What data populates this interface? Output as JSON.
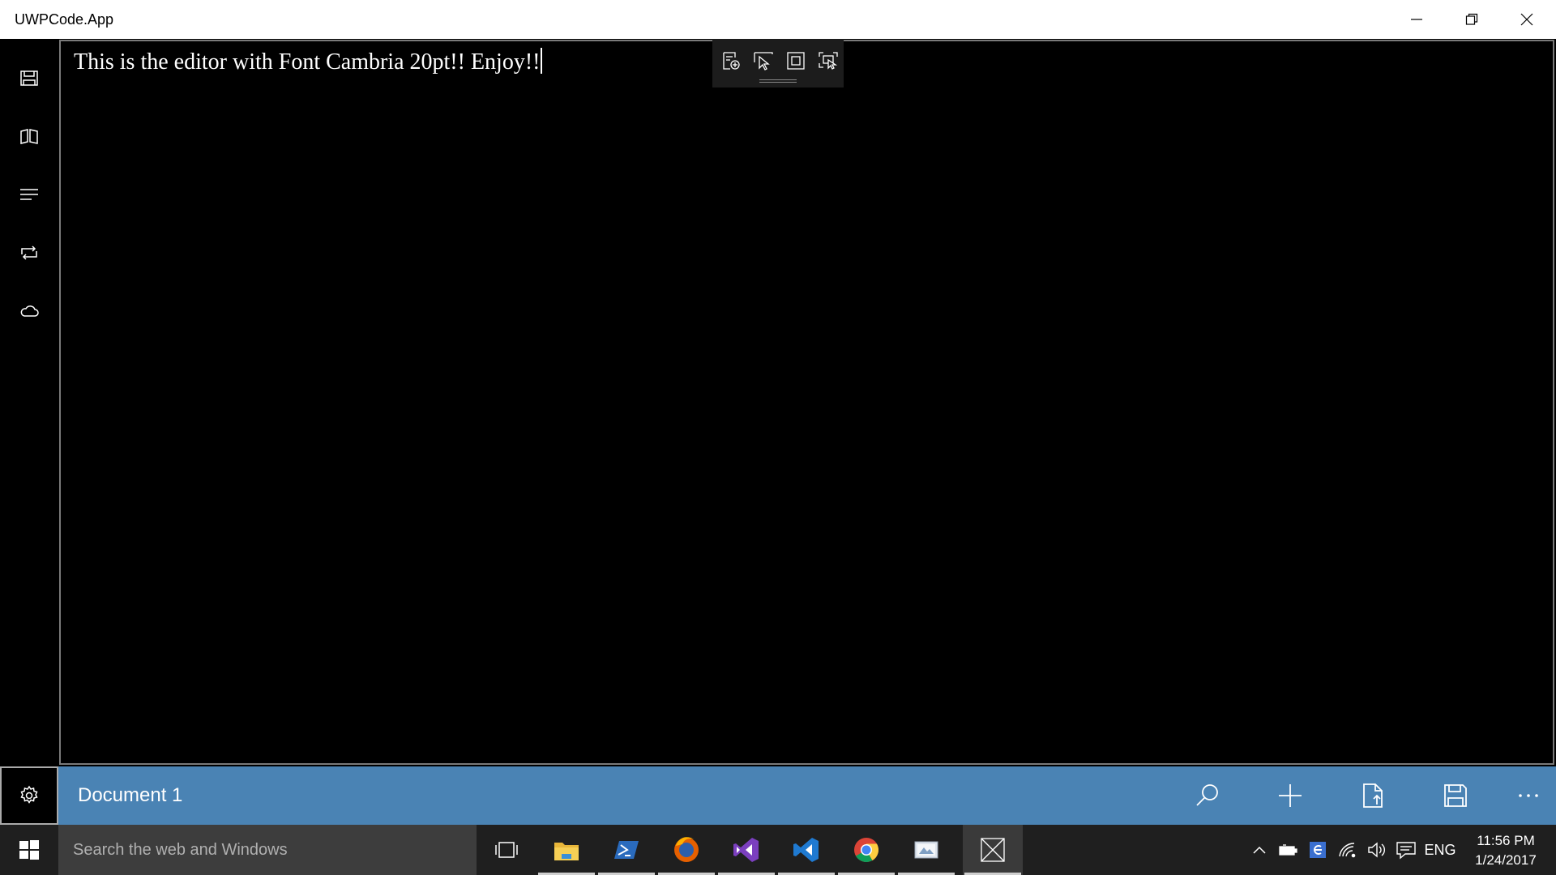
{
  "window": {
    "title": "UWPCode.App"
  },
  "editor": {
    "text": "This is the editor with Font Cambria 20pt!! Enjoy!!"
  },
  "ink_toolbar": {
    "tools": [
      "ink-select-icon",
      "pointer-select-icon",
      "frame-icon",
      "screen-select-icon"
    ]
  },
  "sidebar": {
    "items": [
      {
        "icon": "save-icon"
      },
      {
        "icon": "book-icon"
      },
      {
        "icon": "menu-lines-icon"
      },
      {
        "icon": "repeat-icon"
      },
      {
        "icon": "cloud-icon"
      }
    ],
    "settings_icon": "gear-icon"
  },
  "command_bar": {
    "document_title": "Document 1",
    "buttons": [
      "search-icon",
      "add-icon",
      "export-file-icon",
      "save-icon",
      "more-icon"
    ]
  },
  "taskbar": {
    "search_placeholder": "Search the web and Windows",
    "apps": [
      "task-view",
      "file-explorer",
      "powershell",
      "firefox",
      "visual-studio",
      "vs-code",
      "chrome",
      "paint",
      "uwpcode"
    ],
    "tray": {
      "language": "ENG",
      "time": "11:56 PM",
      "date": "1/24/2017"
    }
  },
  "colors": {
    "accent": "#4a83b4",
    "taskbar": "#1f1f1f",
    "editor_bg": "#000000"
  }
}
